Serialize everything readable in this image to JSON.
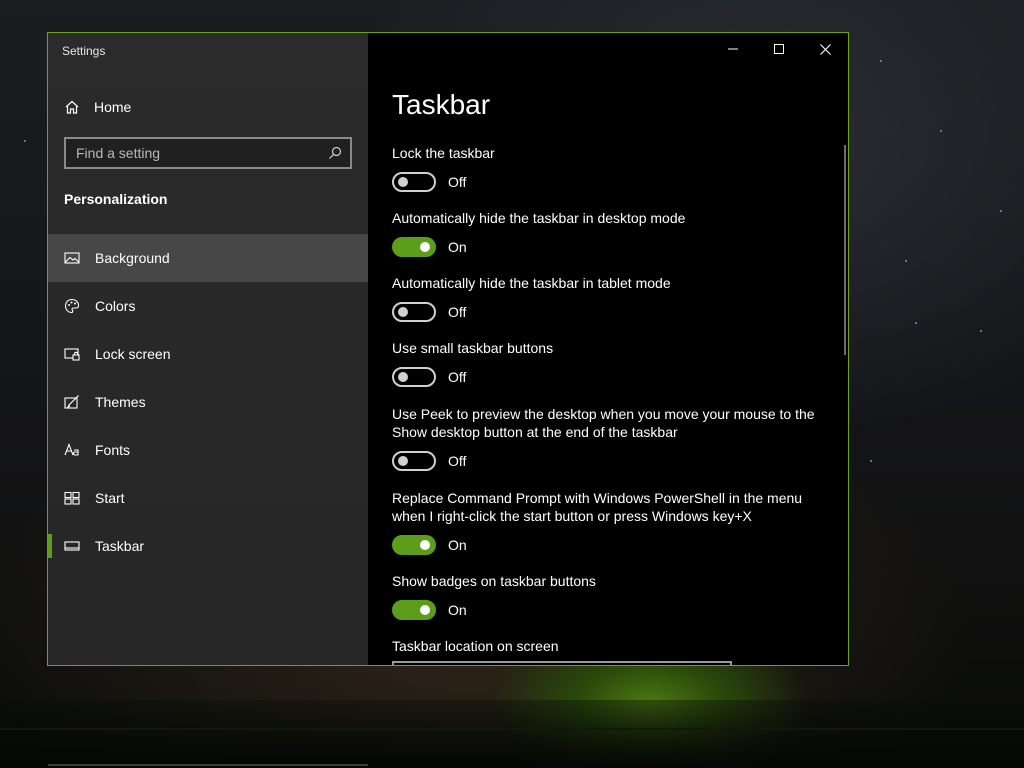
{
  "window": {
    "title": "Settings",
    "accent_color": "#5c9d1b",
    "border_color": "#6aa41c",
    "caption_buttons": [
      "minimize-icon",
      "maximize-icon",
      "close-icon"
    ]
  },
  "sidebar": {
    "home_label": "Home",
    "home_icon": "home-icon",
    "search_placeholder": "Find a setting",
    "search_icon": "search-icon",
    "section_title": "Personalization",
    "items": [
      {
        "label": "Background",
        "icon": "picture-icon",
        "state": "hover"
      },
      {
        "label": "Colors",
        "icon": "palette-icon"
      },
      {
        "label": "Lock screen",
        "icon": "lock-screen-icon"
      },
      {
        "label": "Themes",
        "icon": "brush-icon"
      },
      {
        "label": "Fonts",
        "icon": "font-icon"
      },
      {
        "label": "Start",
        "icon": "start-icon"
      },
      {
        "label": "Taskbar",
        "icon": "taskbar-icon",
        "state": "current"
      }
    ]
  },
  "content": {
    "title": "Taskbar",
    "settings": [
      {
        "label": "Lock the taskbar",
        "on": false,
        "state_text": "Off"
      },
      {
        "label": "Automatically hide the taskbar in desktop mode",
        "on": true,
        "state_text": "On"
      },
      {
        "label": "Automatically hide the taskbar in tablet mode",
        "on": false,
        "state_text": "Off"
      },
      {
        "label": "Use small taskbar buttons",
        "on": false,
        "state_text": "Off"
      },
      {
        "label": "Use Peek to preview the desktop when you move your mouse to the Show desktop button at the end of the taskbar",
        "on": false,
        "state_text": "Off"
      },
      {
        "label": "Replace Command Prompt with Windows PowerShell in the menu when I right-click the start button or press Windows key+X",
        "on": true,
        "state_text": "On"
      },
      {
        "label": "Show badges on taskbar buttons",
        "on": true,
        "state_text": "On"
      }
    ],
    "location_label": "Taskbar location on screen"
  }
}
